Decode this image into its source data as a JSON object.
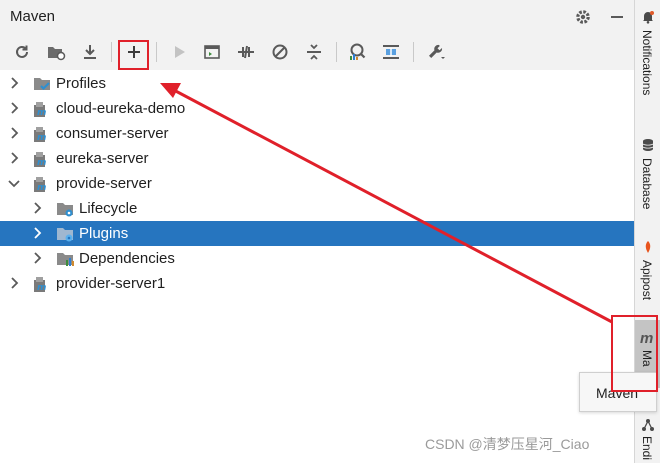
{
  "window": {
    "title": "Maven",
    "settings_icon": "gear-icon",
    "hide_icon": "minus-icon"
  },
  "toolbar": {
    "buttons": [
      {
        "name": "reload-all-projects",
        "icon": "reload-icon"
      },
      {
        "name": "reload-folder",
        "icon": "folder-refresh-icon"
      },
      {
        "name": "download-sources",
        "icon": "download-icon"
      },
      {
        "name": "add-maven-project",
        "icon": "plus-icon",
        "label": "+"
      },
      {
        "name": "run-maven-build",
        "icon": "play-icon"
      },
      {
        "name": "execute-goal",
        "icon": "terminal-icon"
      },
      {
        "name": "toggle-offline",
        "icon": "offline-icon"
      },
      {
        "name": "skip-tests",
        "icon": "skip-icon"
      },
      {
        "name": "collapse-all",
        "icon": "collapse-icon"
      },
      {
        "name": "show-dependencies",
        "icon": "analyze-icon"
      },
      {
        "name": "expand-all",
        "icon": "expand-icon"
      },
      {
        "name": "maven-settings",
        "icon": "wrench-icon"
      }
    ]
  },
  "tree": [
    {
      "label": "Profiles",
      "icon": "profiles-folder-icon",
      "expanded": false,
      "level": 0
    },
    {
      "label": "cloud-eureka-demo",
      "icon": "maven-module-icon",
      "expanded": false,
      "level": 0
    },
    {
      "label": "consumer-server",
      "icon": "maven-module-icon",
      "expanded": false,
      "level": 0
    },
    {
      "label": "eureka-server",
      "icon": "maven-module-icon",
      "expanded": false,
      "level": 0
    },
    {
      "label": "provide-server",
      "icon": "maven-module-icon",
      "expanded": true,
      "level": 0
    },
    {
      "label": "Lifecycle",
      "icon": "lifecycle-folder-icon",
      "expanded": false,
      "level": 1
    },
    {
      "label": "Plugins",
      "icon": "plugins-folder-icon",
      "expanded": false,
      "level": 1,
      "selected": true
    },
    {
      "label": "Dependencies",
      "icon": "dependencies-folder-icon",
      "expanded": false,
      "level": 1
    },
    {
      "label": "provider-server1",
      "icon": "maven-module-icon",
      "expanded": false,
      "level": 0
    }
  ],
  "right_sidebar": {
    "items": [
      {
        "label": "Notifications",
        "icon": "bell-icon"
      },
      {
        "label": "Database",
        "icon": "database-icon"
      },
      {
        "label": "Apipost",
        "icon": "apipost-icon"
      },
      {
        "label": "Ma",
        "icon": "maven-m-icon",
        "active": true
      },
      {
        "label": "Endi",
        "icon": "endpoints-icon"
      }
    ]
  },
  "tooltip": {
    "text": "Maven"
  },
  "watermark": "CSDN @清梦压星河_Ciao",
  "colors": {
    "selection": "#2675bf",
    "annotation": "#e0202a",
    "panel_bg": "#f2f2f2"
  }
}
